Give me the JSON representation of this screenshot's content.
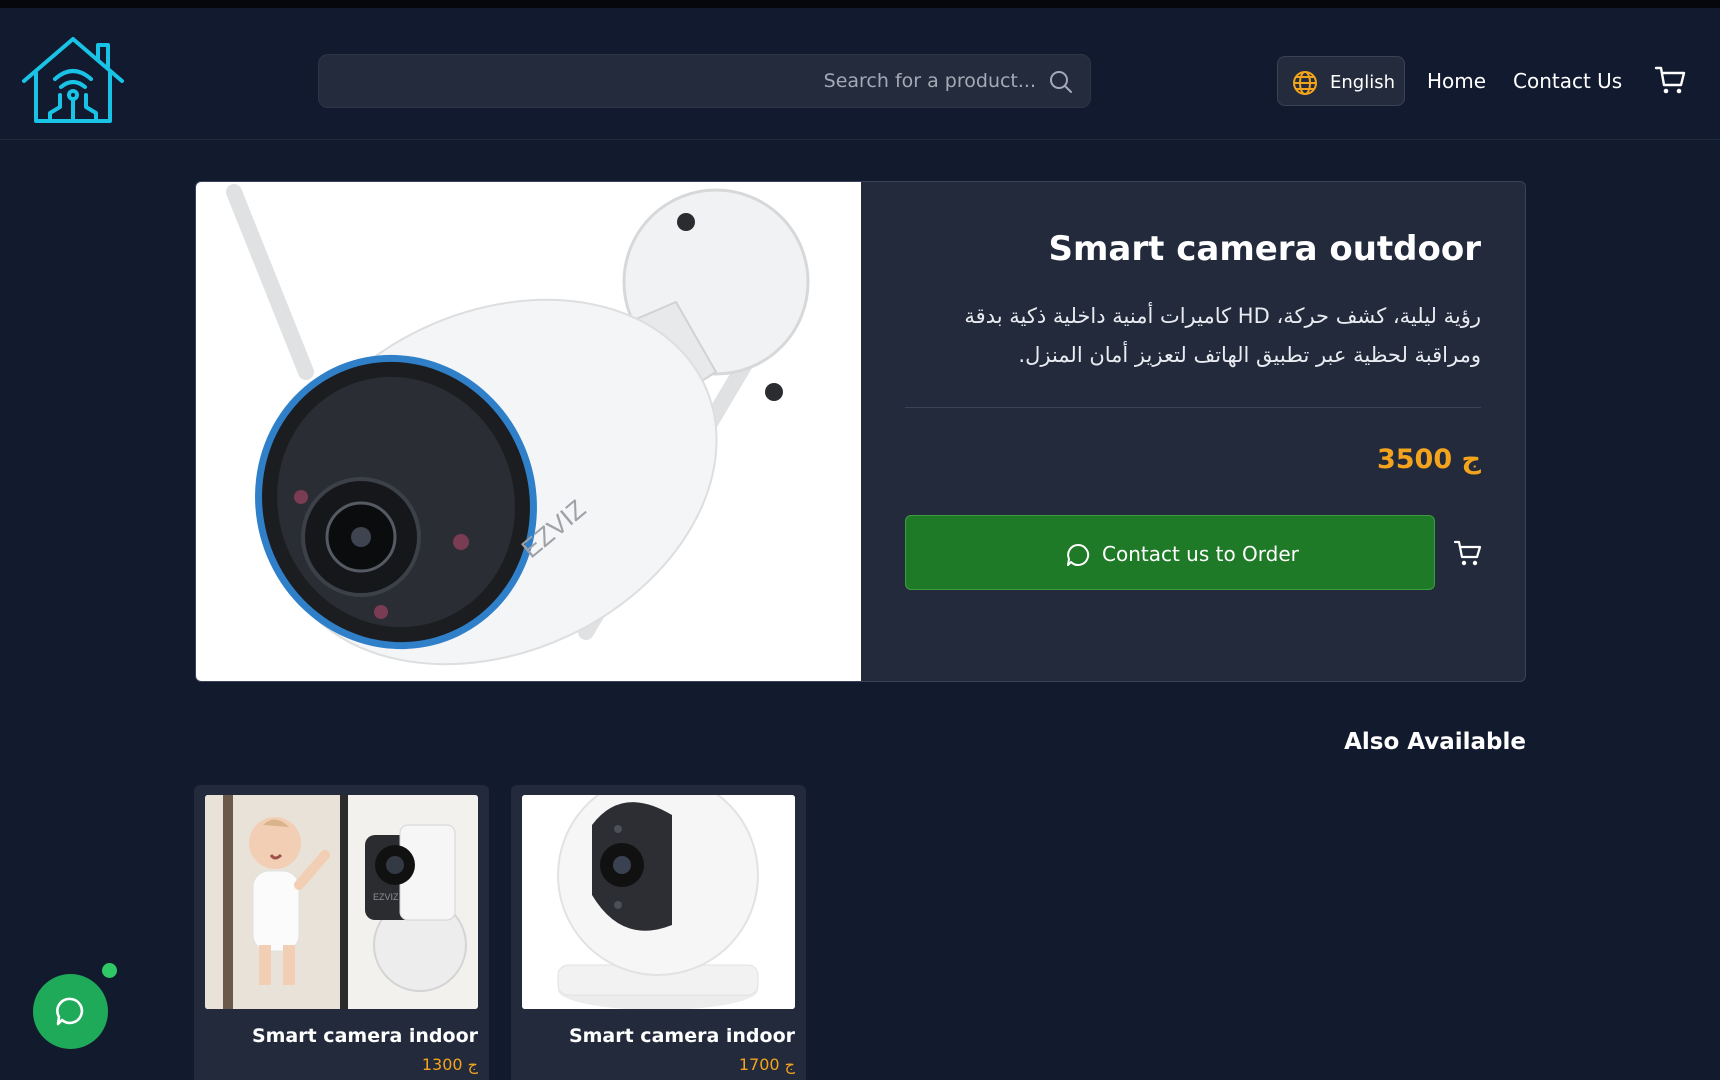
{
  "header": {
    "logo_icon": "smart-home-logo-icon",
    "search": {
      "placeholder": "Search for a product...",
      "icon": "search-icon"
    },
    "language": {
      "label": "English",
      "icon": "globe-icon"
    },
    "nav": {
      "home": "Home",
      "contact": "Contact Us"
    },
    "cart_icon": "cart-icon"
  },
  "product": {
    "title": "Smart camera outdoor",
    "description": "رؤية ليلية، كشف حركة، HD كاميرات أمنية داخلية ذكية بدقة ومراقبة لحظية عبر تطبيق الهاتف لتعزيز أمان المنزل.",
    "price": "3500 ج",
    "order_button": "Contact us to Order",
    "image_brand": "EZVIZ"
  },
  "related": {
    "heading": "Also Available",
    "items": [
      {
        "title": "Smart camera indoor",
        "price": "1300 ج",
        "brand": "EZVIZ"
      },
      {
        "title": "Smart camera indoor",
        "price": "1700 ج"
      }
    ]
  },
  "colors": {
    "background": "#121a2d",
    "card": "#222a3c",
    "accent_price": "#f3a41c",
    "order_green": "#1e7a26",
    "chat_green": "#1faa59",
    "logo_cyan": "#19c3e6"
  }
}
